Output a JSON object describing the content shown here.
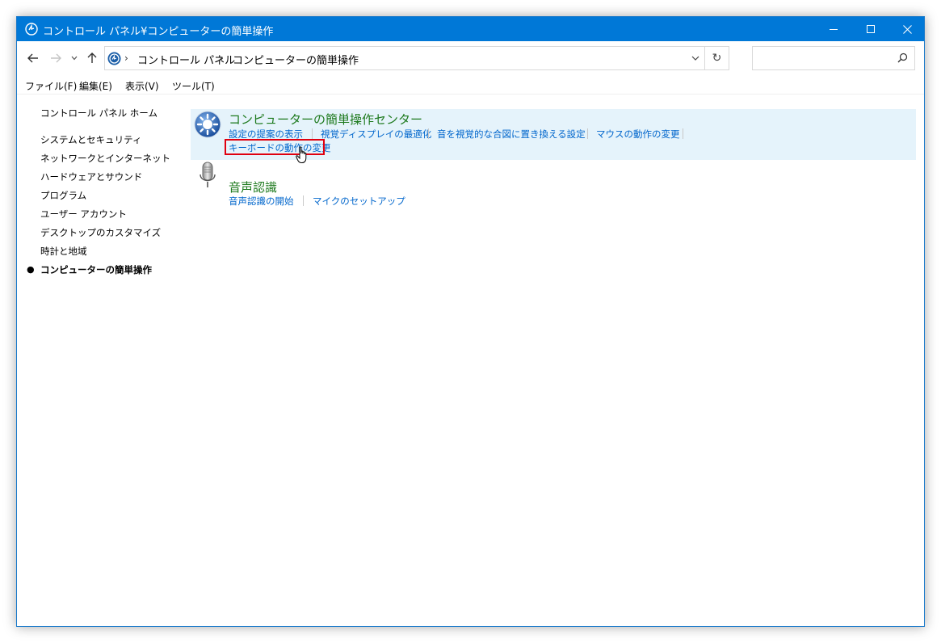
{
  "window": {
    "title": "コントロール パネル¥コンピューターの簡単操作"
  },
  "address": {
    "breadcrumb": [
      "コントロール パネル",
      "コンピューターの簡単操作"
    ],
    "search_placeholder": ""
  },
  "menu": {
    "items": [
      "ファイル(F)",
      "編集(E)",
      "表示(V)",
      "ツール(T)"
    ]
  },
  "sidebar": {
    "home": "コントロール パネル ホーム",
    "items": [
      "システムとセキュリティ",
      "ネットワークとインターネット",
      "ハードウェアとサウンド",
      "プログラム",
      "ユーザー アカウント",
      "デスクトップのカスタマイズ",
      "時計と地域",
      "コンピューターの簡単操作"
    ],
    "current_index": 7
  },
  "categories": [
    {
      "title": "コンピューターの簡単操作センター",
      "icon": "ease-of-access-icon",
      "links": [
        "設定の提案の表示",
        "視覚ディスプレイの最適化",
        "音を視覚的な合図に置き換える設定",
        "マウスの動作の変更",
        "キーボードの動作の変更"
      ],
      "highlighted_link_index": 4
    },
    {
      "title": "音声認識",
      "icon": "microphone-icon",
      "links": [
        "音声認識の開始",
        "マイクのセットアップ"
      ]
    }
  ],
  "colors": {
    "titlebar": "#0078d7",
    "category_title": "#1e7a1e",
    "link": "#0066cc",
    "highlight_bg": "#e5f3fb",
    "annotation_box": "#e0000f"
  }
}
